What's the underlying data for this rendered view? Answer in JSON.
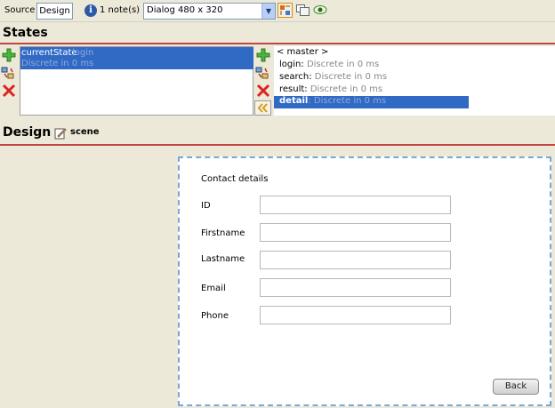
{
  "toolbar": {
    "source_label": "Source",
    "design_label": "Design",
    "notes_label": "1 note(s)",
    "dialog_select": "Dialog 480 x 320",
    "icons": [
      "info-icon",
      "component-icon",
      "frames-icon",
      "eye-icon"
    ]
  },
  "states_panel": {
    "title": "States",
    "left_list": {
      "selected": {
        "name": "currentState",
        "target": "login",
        "transition": "Discrete in 0 ms"
      }
    },
    "right_list": {
      "master": "< master >",
      "items": [
        {
          "name": "login",
          "transition": "Discrete in 0 ms"
        },
        {
          "name": "search",
          "transition": "Discrete in 0 ms"
        },
        {
          "name": "result",
          "transition": "Discrete in 0 ms"
        },
        {
          "name": "detail",
          "transition": "Discrete in 0 ms",
          "selected": true
        }
      ]
    },
    "left_buttons": [
      "add-icon",
      "edit-icon",
      "delete-icon"
    ],
    "right_buttons": [
      "add-icon",
      "edit-icon",
      "delete-icon",
      "move-left-icon"
    ]
  },
  "design_panel": {
    "title": "Design",
    "scene_label": "scene"
  },
  "dialog": {
    "heading": "Contact details",
    "fields": [
      {
        "label": "ID",
        "value": ""
      },
      {
        "label": "Firstname",
        "value": ""
      },
      {
        "label": "Lastname",
        "value": ""
      },
      {
        "label": "Email",
        "value": ""
      },
      {
        "label": "Phone",
        "value": ""
      }
    ],
    "back_label": "Back"
  },
  "colors": {
    "selection": "#316ac5",
    "section_rule": "#c24545",
    "dialog_border": "#7aa7d6",
    "background": "#ece9d8"
  }
}
